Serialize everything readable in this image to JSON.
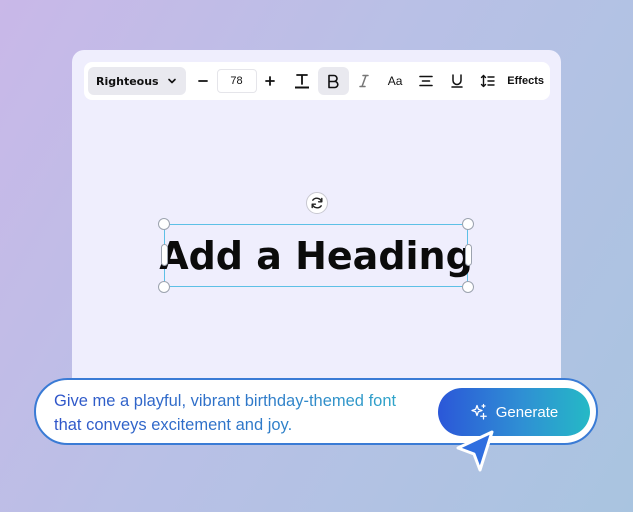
{
  "toolbar": {
    "font_name": "Righteous",
    "font_size": "78",
    "decrease_label": "−",
    "increase_label": "+",
    "effects_label": "Effects",
    "case_label": "Aa",
    "bold_active": true
  },
  "canvas": {
    "heading_text": "Add a Heading"
  },
  "prompt": {
    "text_line1": "Give me a playful, vibrant birthday-themed font",
    "text_line2": "that conveys excitement and joy.",
    "generate_label": "Generate"
  },
  "colors": {
    "selection_border": "#5dc0e6",
    "accent_start": "#2b57d8",
    "accent_end": "#25b9c6",
    "cursor": "#2f6ee0"
  }
}
